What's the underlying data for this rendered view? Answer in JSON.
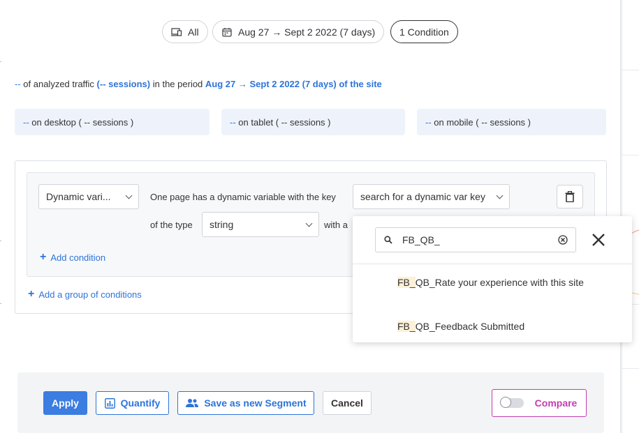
{
  "filters": {
    "device_label": "All",
    "date_label": "Aug 27 → Sept 2 2022 (7 days)",
    "condition_label": "1 Condition"
  },
  "summary": {
    "count": "--",
    "text1": " of analyzed traffic ",
    "sessions": "(-- sessions)",
    "text2": " in the period ",
    "period": "Aug 27 → Sept 2 2022 (7 days) of the site"
  },
  "devices": [
    {
      "count": "--",
      "label": " on desktop ( -- sessions )"
    },
    {
      "count": "--",
      "label": " on tablet ( -- sessions )"
    },
    {
      "count": "--",
      "label": " on mobile ( -- sessions )"
    }
  ],
  "condition": {
    "type_select": "Dynamic vari...",
    "sentence1": "One page has a dynamic variable with the key",
    "key_select": "search for a dynamic var key",
    "sentence2": "of the type",
    "type_value": "string",
    "sentence3": "with a",
    "add_condition": "Add condition",
    "add_group": "Add a group of conditions"
  },
  "dropdown": {
    "search_value": "FB_QB_",
    "options": [
      {
        "match": "FB_",
        "rest": "QB_Rate your experience with this site"
      },
      {
        "match": "FB_",
        "rest": "QB_Feedback Submitted"
      }
    ]
  },
  "footer": {
    "apply": "Apply",
    "quantify": "Quantify",
    "save_segment": "Save as new Segment",
    "cancel": "Cancel",
    "compare": "Compare"
  },
  "colors": {
    "accent": "#2d74da",
    "apply_bg": "#3b7de0",
    "compare": "#c43db0",
    "highlight": "#fdf0d8"
  }
}
